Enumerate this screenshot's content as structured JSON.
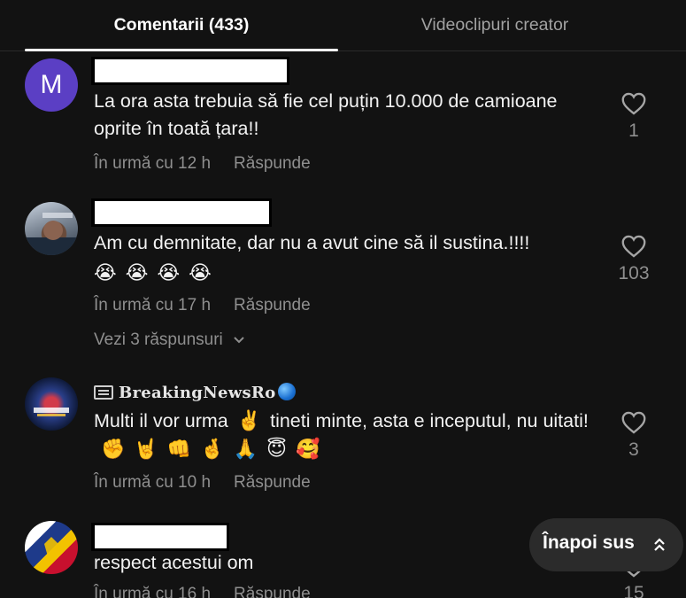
{
  "tabs": {
    "comments": "Comentarii (433)",
    "creator_videos": "Videoclipuri creator"
  },
  "comments": [
    {
      "avatar_letter": "M",
      "text": "La ora asta trebuia să fie cel puțin 10.000 de camioane oprite în toată țara!!",
      "time": "În urmă cu 12 h",
      "reply": "Răspunde",
      "likes": "1"
    },
    {
      "text": "Am cu demnitate, dar nu a avut cine să il sustina.!!!!",
      "emojis": [
        "😭",
        "😭",
        "😭",
        "😭"
      ],
      "time": "În urmă cu 17 h",
      "reply": "Răspunde",
      "likes": "103",
      "view_replies": "Vezi 3 răspunsuri"
    },
    {
      "username": "𝐁𝐫𝐞𝐚𝐤𝐢𝐧𝐠𝐍𝐞𝐰𝐬𝐑𝐨",
      "text_part1": "Multi il vor urma",
      "emoji_inline": "✌️",
      "text_part2": "tineti minte, asta e inceputul, nu uitati!",
      "emojis": [
        "✊",
        "🤘",
        "👊",
        "🤞",
        "🙏",
        "😇",
        "🥰"
      ],
      "time": "În urmă cu 10 h",
      "reply": "Răspunde",
      "likes": "3"
    },
    {
      "text": "respect acestui om",
      "time": "În urmă cu 16 h",
      "reply": "Răspunde",
      "likes": "15"
    }
  ],
  "back_to_top": "Înapoi sus",
  "colors": {
    "background": "#121212",
    "muted_text": "#8f8f8f",
    "avatar_m": "#5b3fc4",
    "button_bg": "#2b2b2b"
  },
  "icons": {
    "like": "heart-outline-icon",
    "expand": "chevron-down-icon",
    "back_to_top": "double-chevron-up-icon"
  }
}
